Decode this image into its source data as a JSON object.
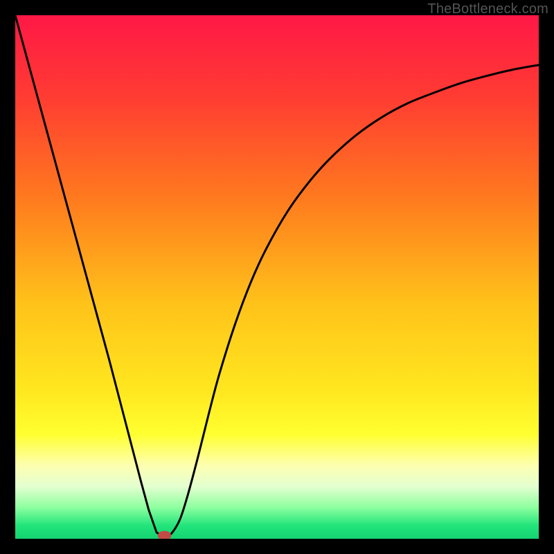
{
  "attribution": "TheBottleneck.com",
  "chart_data": {
    "type": "line",
    "title": "",
    "xlabel": "",
    "ylabel": "",
    "xlim": [
      0,
      100
    ],
    "ylim": [
      0,
      100
    ],
    "grid": false,
    "legend": false,
    "gradient_stops": [
      {
        "offset": 0.0,
        "color": "#ff1846"
      },
      {
        "offset": 0.15,
        "color": "#ff3a33"
      },
      {
        "offset": 0.35,
        "color": "#ff7a1e"
      },
      {
        "offset": 0.55,
        "color": "#ffc21a"
      },
      {
        "offset": 0.72,
        "color": "#ffe81f"
      },
      {
        "offset": 0.8,
        "color": "#ffff30"
      },
      {
        "offset": 0.86,
        "color": "#fdffb0"
      },
      {
        "offset": 0.9,
        "color": "#e4ffd0"
      },
      {
        "offset": 0.94,
        "color": "#8effa0"
      },
      {
        "offset": 0.975,
        "color": "#21e47a"
      },
      {
        "offset": 1.0,
        "color": "#14d371"
      }
    ],
    "series": [
      {
        "name": "bottleneck-curve",
        "x": [
          0.0,
          3.0,
          6.0,
          9.0,
          12.0,
          15.0,
          18.0,
          21.0,
          24.0,
          25.5,
          27.0,
          28.0,
          29.0,
          30.0,
          31.5,
          33.0,
          35.0,
          37.0,
          39.0,
          42.0,
          45.0,
          48.0,
          52.0,
          56.0,
          60.0,
          65.0,
          70.0,
          75.0,
          80.0,
          85.0,
          90.0,
          95.0,
          100.0
        ],
        "y": [
          100.0,
          89.0,
          78.0,
          67.0,
          56.0,
          45.0,
          34.0,
          22.5,
          11.0,
          5.5,
          1.2,
          0.6,
          0.6,
          1.2,
          3.8,
          8.5,
          16.0,
          24.0,
          31.5,
          41.0,
          49.0,
          55.5,
          62.5,
          68.0,
          72.5,
          77.0,
          80.5,
          83.2,
          85.2,
          87.0,
          88.4,
          89.6,
          90.5
        ]
      }
    ],
    "marker": {
      "name": "optimal-point",
      "x": 28.5,
      "y": 0.6,
      "rx": 1.3,
      "ry": 0.9,
      "fill": "#c24a45"
    }
  }
}
